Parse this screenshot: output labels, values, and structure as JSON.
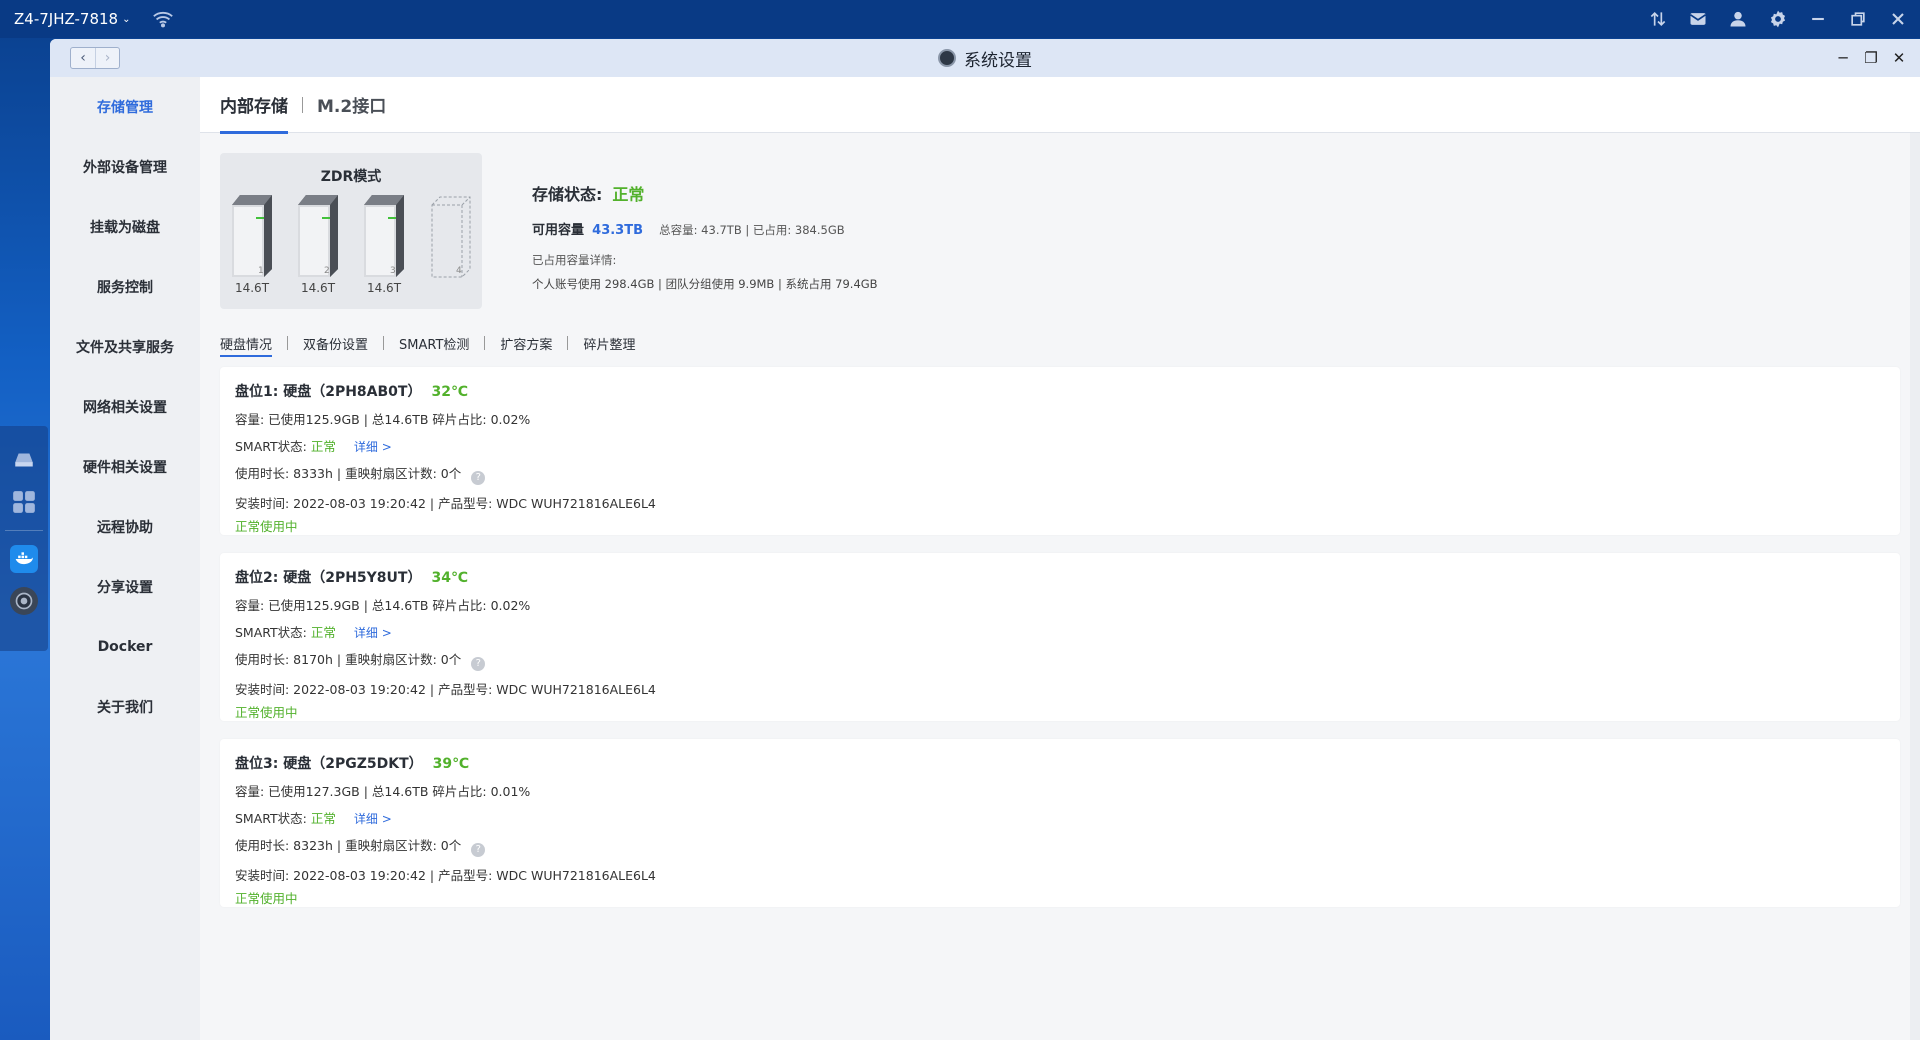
{
  "desktop": {
    "device_name": "Z4-7JHZ-7818"
  },
  "window": {
    "title": "系统设置"
  },
  "sidebar": {
    "items": [
      {
        "label": "存储管理"
      },
      {
        "label": "外部设备管理"
      },
      {
        "label": "挂载为磁盘"
      },
      {
        "label": "服务控制"
      },
      {
        "label": "文件及共享服务"
      },
      {
        "label": "网络相关设置"
      },
      {
        "label": "硬件相关设置"
      },
      {
        "label": "远程协助"
      },
      {
        "label": "分享设置"
      },
      {
        "label": "Docker"
      },
      {
        "label": "关于我们"
      }
    ]
  },
  "tabs": {
    "internal": "内部存储",
    "m2": "M.2接口"
  },
  "summary": {
    "mode": "ZDR模式",
    "drives": [
      {
        "slot": "1",
        "size": "14.6T",
        "present": true
      },
      {
        "slot": "2",
        "size": "14.6T",
        "present": true
      },
      {
        "slot": "3",
        "size": "14.6T",
        "present": true
      },
      {
        "slot": "4",
        "size": "",
        "present": false
      }
    ],
    "status_label": "存储状态:",
    "status_value": "正常",
    "avail_label": "可用容量",
    "avail_value": "43.3TB",
    "capacity_detail": "总容量: 43.7TB | 已占用: 384.5GB",
    "used_detail_label": "已占用容量详情:",
    "used_detail": "个人账号使用 298.4GB | 团队分组使用 9.9MB | 系统占用 79.4GB"
  },
  "subtabs": [
    "硬盘情况",
    "双备份设置",
    "SMART检测",
    "扩容方案",
    "碎片整理"
  ],
  "disks": [
    {
      "title": "盘位1:  硬盘（2PH8AB0T）",
      "temp": "32℃",
      "capacity": "容量:  已使用125.9GB | 总14.6TB    碎片占比:  0.02%",
      "smart_label": "SMART状态:",
      "smart_value": "正常",
      "detail_link": "详细 >",
      "usage": "使用时长:  8333h | 重映射扇区计数:  0个",
      "install": "安装时间:  2022-08-03 19:20:42 | 产品型号:  WDC WUH721816ALE6L4",
      "state": "正常使用中"
    },
    {
      "title": "盘位2:  硬盘（2PH5Y8UT）",
      "temp": "34℃",
      "capacity": "容量:  已使用125.9GB | 总14.6TB    碎片占比:  0.02%",
      "smart_label": "SMART状态:",
      "smart_value": "正常",
      "detail_link": "详细 >",
      "usage": "使用时长:  8170h | 重映射扇区计数:  0个",
      "install": "安装时间:  2022-08-03 19:20:42 | 产品型号:  WDC WUH721816ALE6L4",
      "state": "正常使用中"
    },
    {
      "title": "盘位3:  硬盘（2PGZ5DKT）",
      "temp": "39℃",
      "capacity": "容量:  已使用127.3GB | 总14.6TB    碎片占比:  0.01%",
      "smart_label": "SMART状态:",
      "smart_value": "正常",
      "detail_link": "详细 >",
      "usage": "使用时长:  8323h | 重映射扇区计数:  0个",
      "install": "安装时间:  2022-08-03 19:20:42 | 产品型号:  WDC WUH721816ALE6L4",
      "state": "正常使用中"
    }
  ],
  "colors": {
    "accent": "#2f6bdc",
    "ok": "#52b12c",
    "topbar": "#093a85"
  }
}
